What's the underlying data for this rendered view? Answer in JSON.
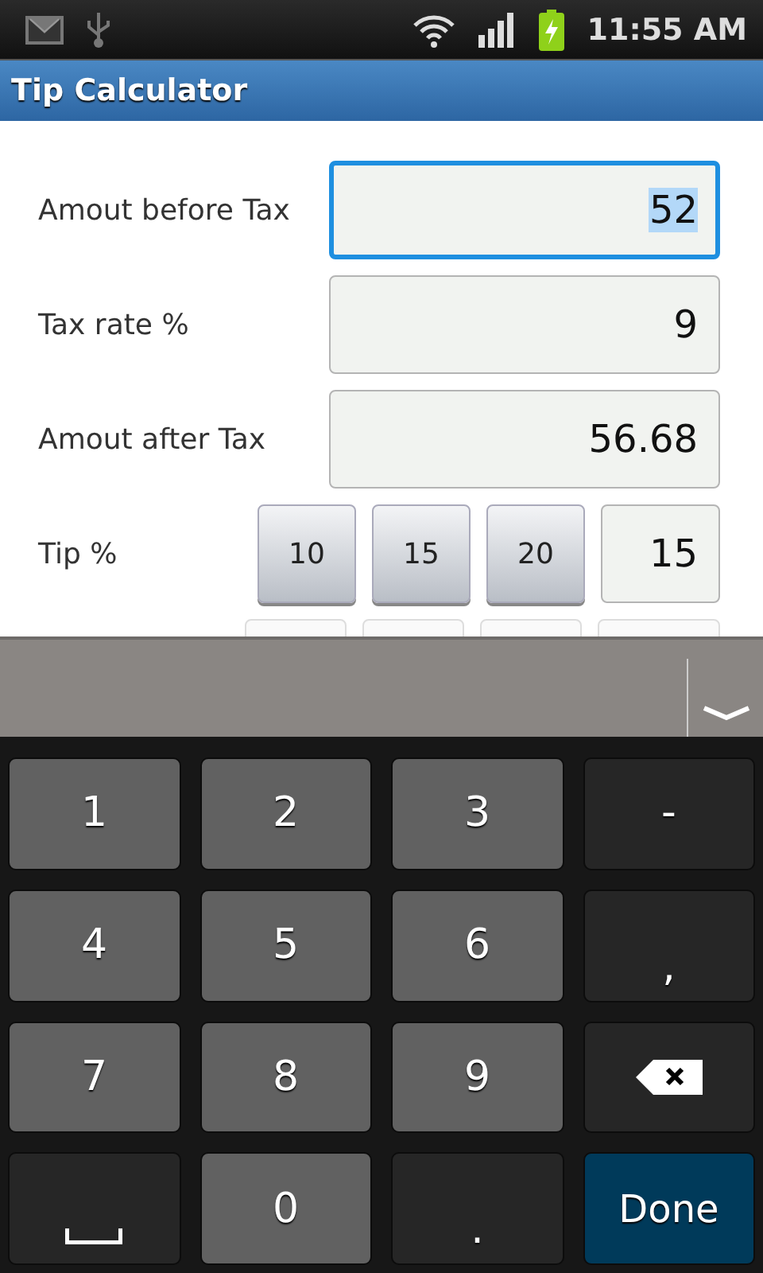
{
  "status_bar": {
    "time": "11:55 AM"
  },
  "title_bar": {
    "title": "Tip Calculator"
  },
  "fields": [
    {
      "label": "Amout before Tax",
      "value": "52",
      "focused": true,
      "selected": true
    },
    {
      "label": "Tax rate %",
      "value": "9",
      "focused": false,
      "selected": false
    },
    {
      "label": "Amout after Tax",
      "value": "56.68",
      "focused": false,
      "selected": false
    }
  ],
  "tip": {
    "label": "Tip %",
    "presets": [
      "10",
      "15",
      "20"
    ],
    "value": "15"
  },
  "keyboard": {
    "keys": [
      {
        "kind": "digit",
        "label": "1"
      },
      {
        "kind": "digit",
        "label": "2"
      },
      {
        "kind": "digit",
        "label": "3"
      },
      {
        "kind": "symbol",
        "label": "-"
      },
      {
        "kind": "digit",
        "label": "4"
      },
      {
        "kind": "digit",
        "label": "5"
      },
      {
        "kind": "digit",
        "label": "6"
      },
      {
        "kind": "mark",
        "label": ","
      },
      {
        "kind": "digit",
        "label": "7"
      },
      {
        "kind": "digit",
        "label": "8"
      },
      {
        "kind": "digit",
        "label": "9"
      },
      {
        "kind": "backspace"
      },
      {
        "kind": "space"
      },
      {
        "kind": "digit",
        "label": "0"
      },
      {
        "kind": "mark",
        "label": "."
      },
      {
        "kind": "done",
        "label": "Done"
      }
    ]
  }
}
